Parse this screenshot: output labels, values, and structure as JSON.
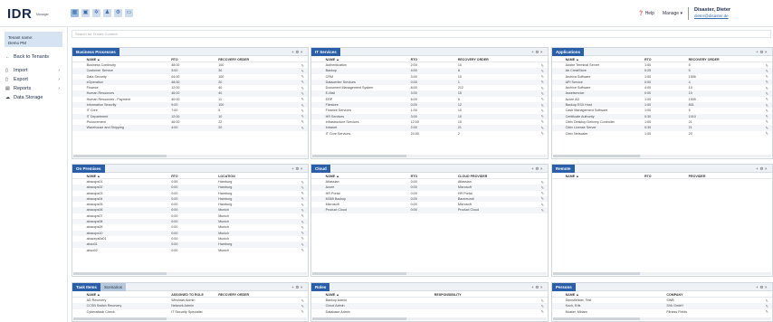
{
  "app": {
    "logo": "IDR",
    "logo_sub": "Manager"
  },
  "topbar": {
    "help": "❓ Help",
    "manage": "Manage ▾",
    "user_name": "Disaster, Dieter",
    "user_email": "dieter@disaster.de"
  },
  "sidebar": {
    "tenant_label": "Tenant name:",
    "tenant_value": "Demo PM",
    "back": "Back to Tenants",
    "items": [
      {
        "label": "Import",
        "icon": "import-icon"
      },
      {
        "label": "Export",
        "icon": "export-icon"
      },
      {
        "label": "Reports",
        "icon": "reports-icon"
      },
      {
        "label": "Data Storage",
        "icon": "data-storage-icon"
      }
    ]
  },
  "search": {
    "placeholder": "Search for Tenant Content"
  },
  "panels": {
    "business_processes": {
      "title": "Business Processes",
      "columns": [
        "NAME ▲",
        "RTO",
        "RECOVERY ORDER"
      ],
      "rows": [
        [
          "Business Continuity",
          "48:00",
          "100"
        ],
        [
          "Customer Service",
          "3:00",
          "30"
        ],
        [
          "Data Security",
          "04:00",
          "100"
        ],
        [
          "eOperation",
          "48:00",
          "20"
        ],
        [
          "Finance",
          "12:00",
          "40"
        ],
        [
          "Human Resources",
          "46:00",
          "40"
        ],
        [
          "Human Resources - Payment",
          "40:00",
          "11"
        ],
        [
          "Information Security",
          "9:00",
          "100"
        ],
        [
          "IT Core",
          "7:00",
          "5"
        ],
        [
          "IT Department",
          "12:00",
          "10"
        ],
        [
          "Procurement",
          "46:00",
          "22"
        ],
        [
          "Warehouse and Shipping",
          "4:00",
          "20"
        ]
      ]
    },
    "it_services": {
      "title": "IT Services",
      "columns": [
        "NAME ▲",
        "RTO",
        "RECOVERY ORDER"
      ],
      "rows": [
        [
          "Authentication",
          "2:00",
          "10"
        ],
        [
          "Backup",
          "4:00",
          "8"
        ],
        [
          "CRM",
          "3:00",
          "10"
        ],
        [
          "Datacenter Services",
          "0:00",
          "1"
        ],
        [
          "Document Management System",
          "8:00",
          "212"
        ],
        [
          "E-Mail",
          "3:00",
          "15"
        ],
        [
          "ERP",
          "6:00",
          "5"
        ],
        [
          "Filestore",
          "0:00",
          "12"
        ],
        [
          "Finance Services",
          "1:00",
          "10"
        ],
        [
          "HR Services",
          "3:00",
          "10"
        ],
        [
          "Infrastructure Services",
          "12:00",
          "10"
        ],
        [
          "Intranet",
          "2:00",
          "21"
        ],
        [
          "IT Core Services",
          "24:00",
          "2"
        ]
      ]
    },
    "applications": {
      "title": "Applications",
      "columns": [
        "NAME ▲",
        "RTO",
        "RECOVERY ORDER"
      ],
      "rows": [
        [
          "Adobe Terminal Server",
          "1:00",
          "5"
        ],
        [
          "Ab CreatStore",
          "0:25",
          "5"
        ],
        [
          "Archiva Software",
          "1:00",
          "1506"
        ],
        [
          "API Service",
          "0:00",
          "4"
        ],
        [
          "Archive Software",
          "4:00",
          "10"
        ],
        [
          "Assetservice",
          "0:00",
          "10"
        ],
        [
          "Azure AD",
          "1:00",
          "1505"
        ],
        [
          "Backup ESX Host",
          "1:00",
          "801"
        ],
        [
          "Cash Management Software",
          "1:00",
          "5"
        ],
        [
          "Certificate Authority",
          "0:30",
          "1010"
        ],
        [
          "Citrix Desktop Delivery Controller",
          "1:00",
          "21"
        ],
        [
          "Citrix License Server",
          "0:30",
          "21"
        ],
        [
          "Citrix Netscaler",
          "1:00",
          "20"
        ]
      ]
    },
    "on_premises": {
      "title": "On Premises",
      "columns": [
        "NAME ▲",
        "RTO",
        "LOCATION"
      ],
      "rows": [
        [
          "abaccps01",
          "0:55",
          "Hamburg"
        ],
        [
          "abaccps02",
          "0:00",
          "Hamburg"
        ],
        [
          "abaccps03",
          "0:00",
          "Hamburg"
        ],
        [
          "abaccps04",
          "0:00",
          "Hamburg"
        ],
        [
          "abaccps05",
          "0:00",
          "Hamburg"
        ],
        [
          "abaccps06",
          "0:00",
          "Munich"
        ],
        [
          "abaccps07",
          "0:00",
          "Munich"
        ],
        [
          "abaccps08",
          "0:00",
          "Munich"
        ],
        [
          "abaccps09",
          "0:00",
          "Munich"
        ],
        [
          "abaccps10",
          "0:00",
          "Munich"
        ],
        [
          "abaceps0c01",
          "0:00",
          "Munich"
        ],
        [
          "abco01",
          "0:00",
          "Hamburg"
        ],
        [
          "abco02",
          "0:00",
          "Munich"
        ]
      ]
    },
    "cloud": {
      "title": "Cloud",
      "columns": [
        "NAME ▲",
        "RTO",
        "CLOUD PROVIDER"
      ],
      "rows": [
        [
          "Atlassian",
          "0:00",
          "Atlassian"
        ],
        [
          "Azure",
          "0:00",
          "Microsoft"
        ],
        [
          "HR Portal",
          "0:00",
          "HR Portal"
        ],
        [
          "M365 Backup",
          "0:00",
          "Baramundi"
        ],
        [
          "Microsoft",
          "0:00",
          "Microsoft"
        ],
        [
          "Product Cloud",
          "0:00",
          "Product Cloud"
        ]
      ]
    },
    "remote": {
      "title": "Remote",
      "columns": [
        "NAME ▲",
        "RTO",
        "PROVIDER"
      ],
      "rows": []
    },
    "task_items": {
      "title": "Task Items",
      "title2": "Scenarios",
      "columns": [
        "NAME ▲",
        "ASSIGNED TO ROLE",
        "RECOVERY ORDER"
      ],
      "rows": [
        [
          "AD Recovery",
          "Windows Admin",
          ""
        ],
        [
          "CCSB Switch Recovery",
          "Network Admin",
          ""
        ],
        [
          "Cyberattack Check",
          "IT Security Specialist",
          ""
        ]
      ]
    },
    "roles": {
      "title": "Roles",
      "columns": [
        "NAME ▲",
        "RESPONSIBILITY"
      ],
      "rows": [
        [
          "Backup Admin",
          ""
        ],
        [
          "Cloud Admin",
          ""
        ],
        [
          "Database Admin",
          ""
        ]
      ]
    },
    "persons": {
      "title": "Persons",
      "columns": [
        "NAME ▲",
        "COMPANY"
      ],
      "rows": [
        [
          "Dienstleister, Test",
          "SWB"
        ],
        [
          "Koch, Erik",
          "SVk GmbH"
        ],
        [
          "Muster, Miriam",
          "Fitness Fields"
        ]
      ]
    }
  }
}
